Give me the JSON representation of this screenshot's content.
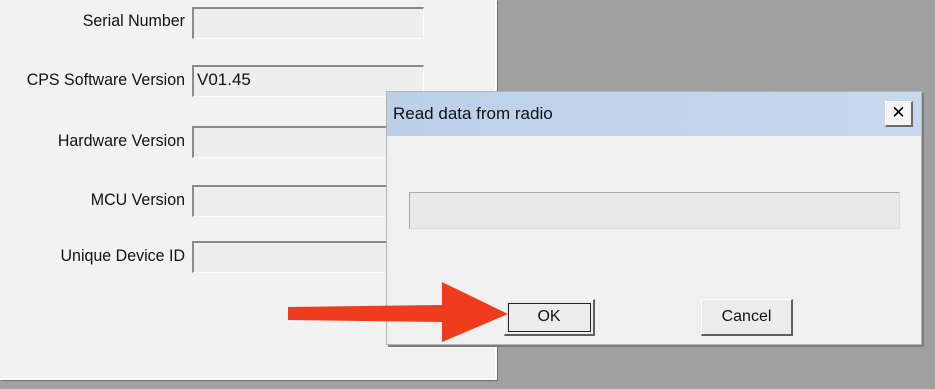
{
  "info_panel": {
    "fields": [
      {
        "label": "Serial Number",
        "value": ""
      },
      {
        "label": "CPS Software Version",
        "value": "V01.45"
      },
      {
        "label": "Hardware Version",
        "value": ""
      },
      {
        "label": "MCU Version",
        "value": ""
      },
      {
        "label": "Unique Device ID",
        "value": ""
      }
    ]
  },
  "dialog": {
    "title": "Read data from radio",
    "close_glyph": "✕",
    "close_icon": "close-icon",
    "progress": 0,
    "ok_label": "OK",
    "cancel_label": "Cancel"
  },
  "annotation": {
    "arrow_color": "#f03c1e",
    "arrow_icon": "arrow-right-icon"
  }
}
